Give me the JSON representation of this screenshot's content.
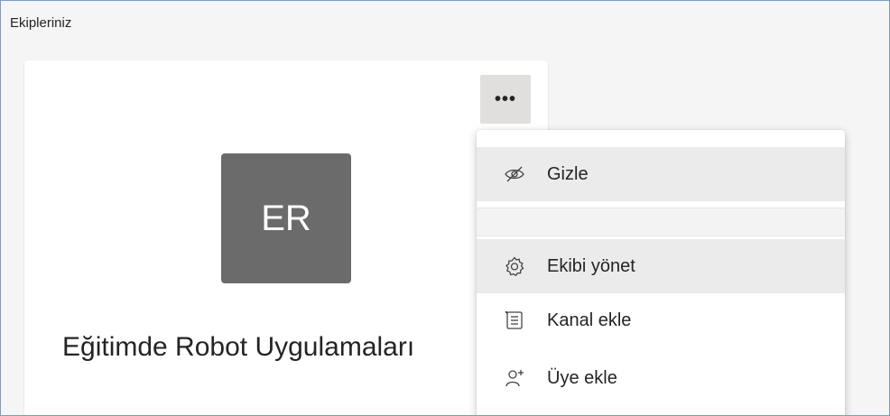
{
  "section": {
    "title": "Ekipleriniz"
  },
  "card": {
    "more_label": "•••",
    "avatar_initials": "ER",
    "team_name": "Eğitimde Robot Uygulamaları"
  },
  "menu": {
    "items": [
      {
        "label": "Gizle",
        "icon": "hide-eye-icon"
      },
      {
        "label": "Ekibi yönet",
        "icon": "gear-icon"
      },
      {
        "label": "Kanal ekle",
        "icon": "channel-list-icon"
      },
      {
        "label": "Üye ekle",
        "icon": "add-member-icon"
      }
    ]
  },
  "colors": {
    "avatar_bg": "#6b6b6b",
    "hover_bg": "#ebebeb",
    "frame_border": "#7a9cc6"
  }
}
